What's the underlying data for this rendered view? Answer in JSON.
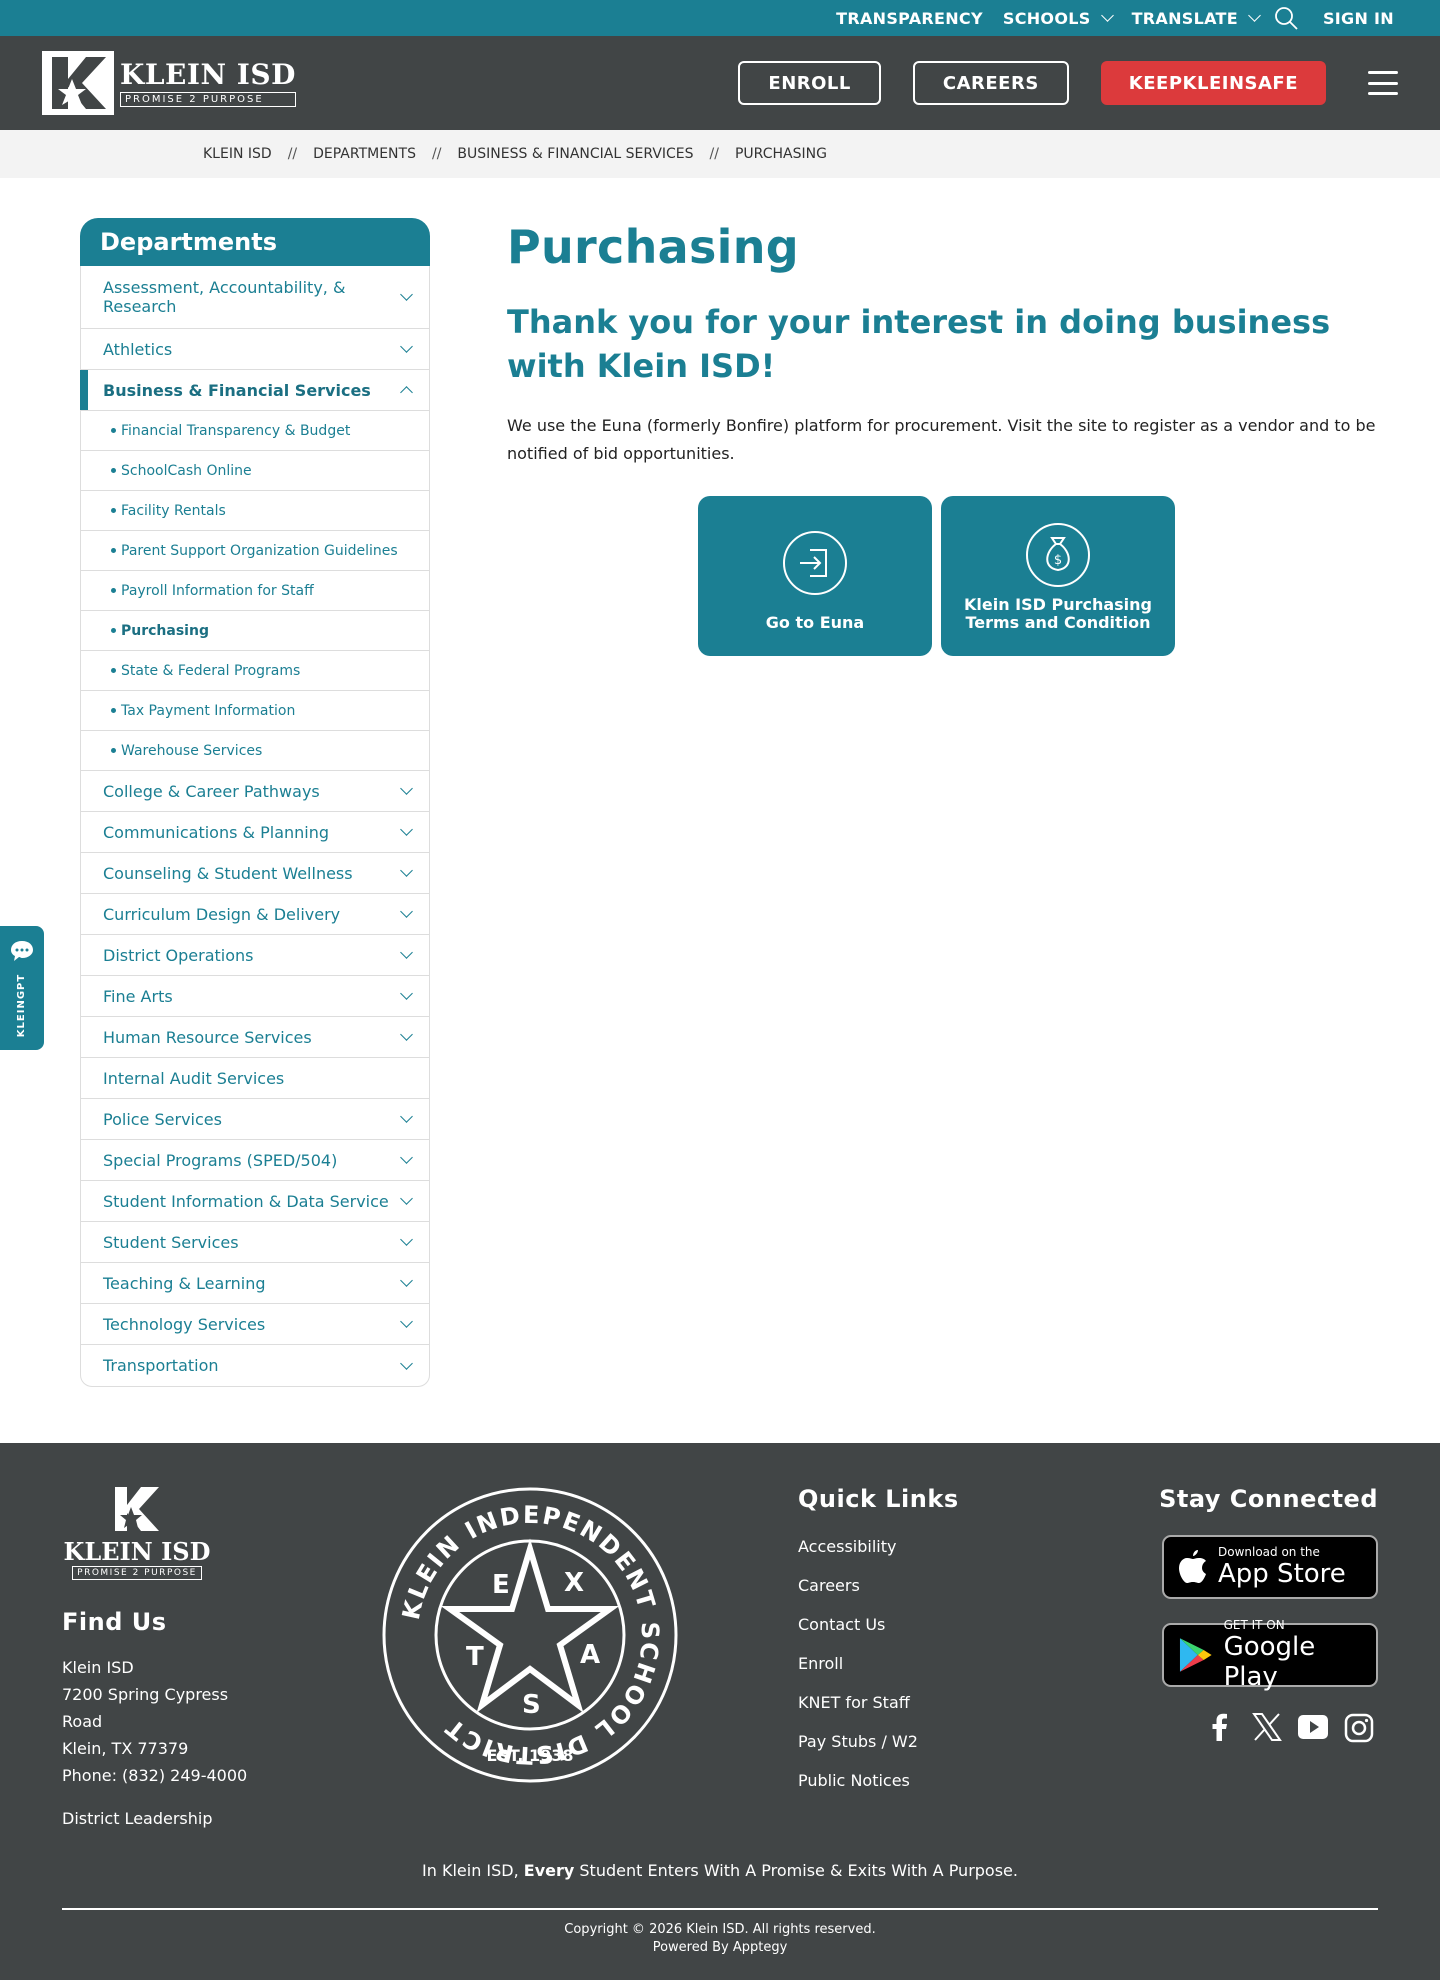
{
  "utility": {
    "transparency": "TRANSPARENCY",
    "schools": "SCHOOLS",
    "translate": "TRANSLATE",
    "sign_in": "SIGN IN"
  },
  "header": {
    "logo_name": "KLEIN ISD",
    "logo_tag": "PROMISE 2 PURPOSE",
    "enroll": "ENROLL",
    "careers": "CAREERS",
    "keep_safe": "KEEPKLEINSAFE"
  },
  "breadcrumb": {
    "items": [
      "KLEIN ISD",
      "DEPARTMENTS",
      "BUSINESS & FINANCIAL SERVICES",
      "PURCHASING"
    ],
    "separator": "//"
  },
  "sidebar": {
    "title": "Departments",
    "items_before": [
      {
        "label": "Assessment, Accountability, & Research"
      },
      {
        "label": "Athletics"
      }
    ],
    "active": "Business & Financial Services",
    "sub_items": [
      "Financial Transparency & Budget",
      "SchoolCash Online",
      "Facility Rentals",
      "Parent Support Organization Guidelines",
      "Payroll Information for Staff",
      "Purchasing",
      "State & Federal Programs",
      "Tax Payment Information",
      "Warehouse Services"
    ],
    "items_after": [
      "College & Career Pathways",
      "Communications & Planning",
      "Counseling & Student Wellness",
      "Curriculum Design & Delivery",
      "District Operations",
      "Fine Arts",
      "Human Resource Services",
      "Internal Audit Services",
      "Police Services",
      "Special Programs (SPED/504)",
      "Student Information & Data Service",
      "Student Services",
      "Teaching & Learning",
      "Technology Services",
      "Transportation"
    ]
  },
  "content": {
    "title": "Purchasing",
    "subtitle": "Thank you for your interest in doing business with Klein ISD!",
    "intro": "We use the Euna (formerly Bonfire) platform for procurement. Visit the site to register as a vendor and to be notified of bid opportunities.",
    "tile_euna": "Go to Euna",
    "tile_terms": "Klein ISD Purchasing Terms and Condition"
  },
  "gpt_tab": {
    "label": "KLEINGPT"
  },
  "footer": {
    "logo_name": "KLEIN ISD",
    "logo_tag": "PROMISE 2 PURPOSE",
    "find_us": "Find Us",
    "address_lines": [
      "Klein ISD",
      "7200 Spring Cypress Road",
      "Klein, TX 77379"
    ],
    "phone_label": "Phone: ",
    "phone": "(832) 249-4000",
    "district_leadership": "District Leadership",
    "seal": {
      "ring_text": "KLEIN INDEPENDENT SCHOOL DISTRICT",
      "est": "EST. 1938",
      "letters": [
        "T",
        "E",
        "X",
        "A",
        "S"
      ]
    },
    "quick_links_title": "Quick Links",
    "quick_links": [
      "Accessibility",
      "Careers",
      "Contact Us",
      "Enroll",
      "KNET for Staff",
      "Pay Stubs / W2",
      "Public Notices"
    ],
    "stay_title": "Stay Connected",
    "app_store_small": "Download on the",
    "app_store_big": "App Store",
    "google_small": "GET IT ON",
    "google_big": "Google Play",
    "tagline_pre": "In Klein ISD, ",
    "tagline_bold": "Every",
    "tagline_post": " Student Enters With A Promise & Exits With A Purpose.",
    "copyright": "Copyright © 2026 Klein ISD. All rights reserved.",
    "powered": "Powered By Apptegy"
  }
}
